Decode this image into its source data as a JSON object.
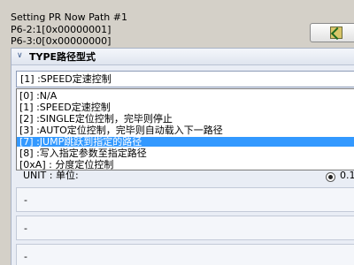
{
  "header": {
    "title": "Setting PR Now Path #1",
    "p6_2": "P6-2:1[0x00000001]",
    "p6_3": "P6-3:0[0x00000000]"
  },
  "top_button": {
    "icon": "confirm-arrow-icon"
  },
  "section": {
    "label": "TYPE路径型式"
  },
  "type_select": {
    "value": "[1] :SPEED定速控制"
  },
  "dropdown": {
    "options": [
      "[0] :N/A",
      "[1] :SPEED定速控制",
      "[2] :SINGLE定位控制，完毕则停止",
      "[3] :AUTO定位控制，完毕则自动载入下一路径",
      "[7] :JUMP跳跃到指定的路径",
      "[8] :写入指定参数至指定路径",
      "[0xA] : 分度定位控制"
    ],
    "selected_index": 4
  },
  "unit": {
    "label": "UNIT : 单位:",
    "radio_label": "0.1"
  },
  "rows": [
    {
      "text": "-"
    },
    {
      "text": "-"
    },
    {
      "text": "-"
    }
  ],
  "colors": {
    "selection": "#3399ff",
    "panel": "#e9edf5",
    "window": "#d4d0c8"
  }
}
